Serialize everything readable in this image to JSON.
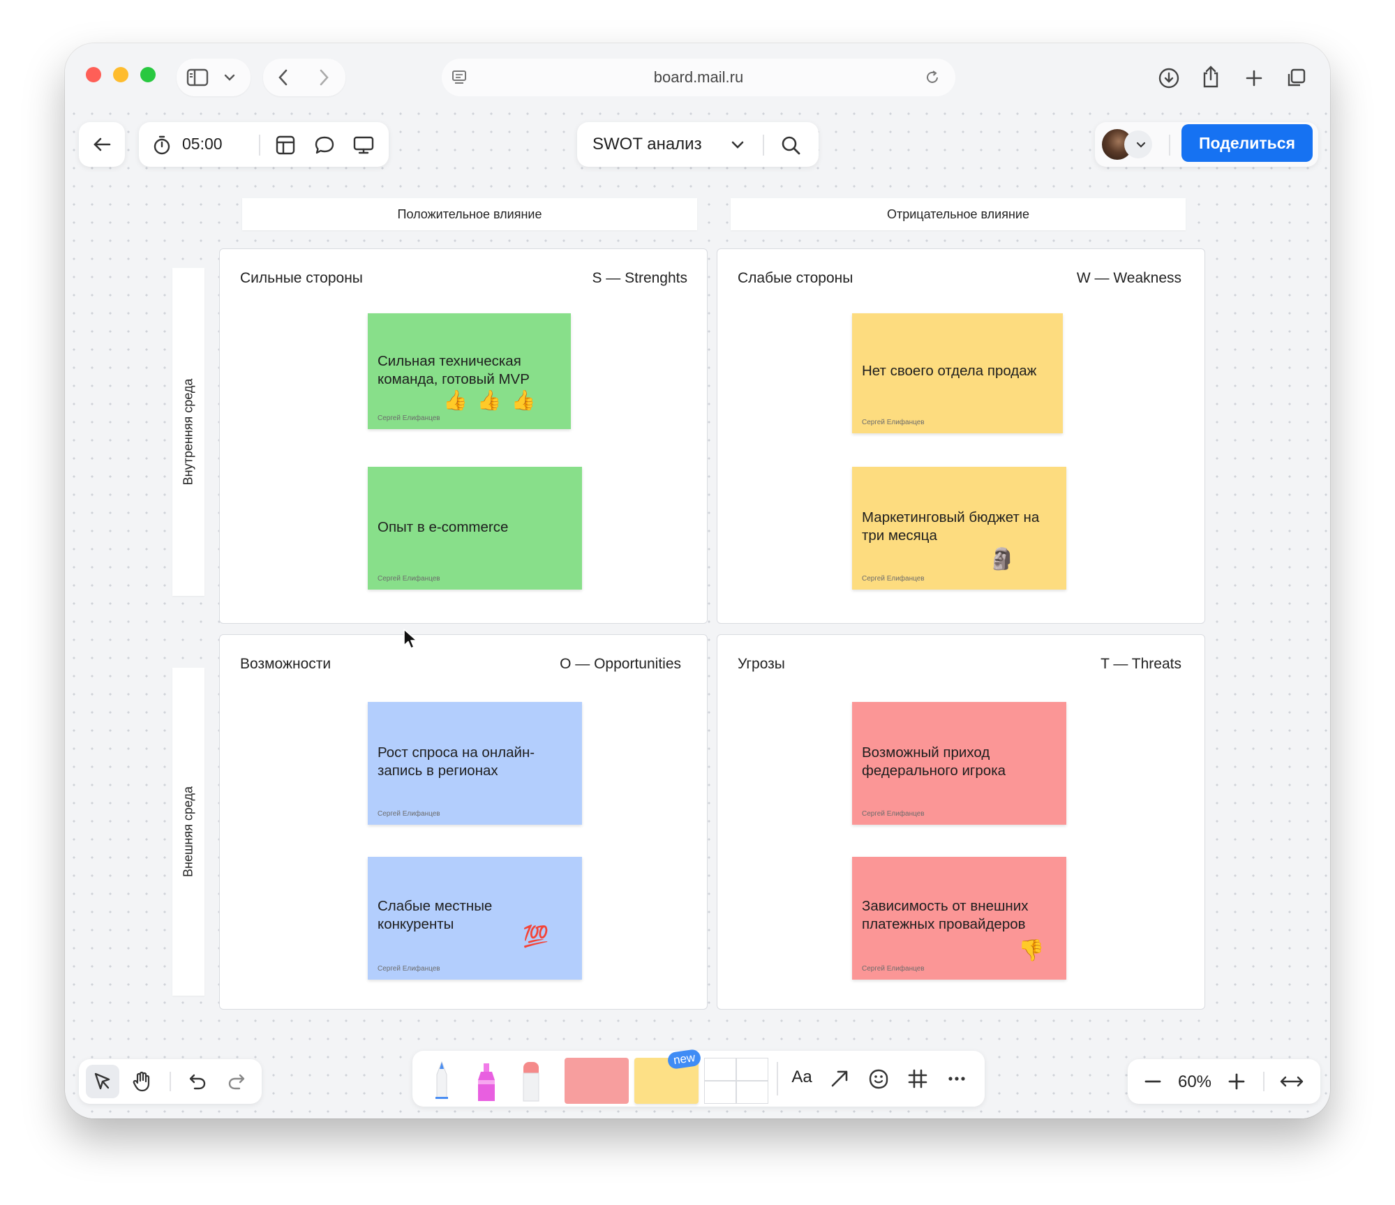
{
  "browser": {
    "url": "board.mail.ru"
  },
  "toolbar": {
    "timer": "05:00",
    "board_title": "SWOT анализ",
    "share_label": "Поделиться"
  },
  "board": {
    "col_headers": [
      "Положительное влияние",
      "Отрицательное влияние"
    ],
    "row_headers": [
      "Внутренняя среда",
      "Внешняя среда"
    ],
    "quadrants": [
      {
        "title_ru": "Сильные стороны",
        "title_en": "S — Strenghts",
        "notes": [
          {
            "text": "Сильная техническая команда, готовый MVP",
            "author": "Сергей Елифанцев",
            "emoji": "👍👍👍"
          },
          {
            "text": "Опыт в e-commerce",
            "author": "Сергей Елифанцев",
            "emoji": ""
          }
        ]
      },
      {
        "title_ru": "Слабые стороны",
        "title_en": "W — Weakness",
        "notes": [
          {
            "text": "Нет своего отдела продаж",
            "author": "Сергей Елифанцев",
            "emoji": ""
          },
          {
            "text": "Маркетинговый бюджет на три месяца",
            "author": "Сергей Елифанцев",
            "emoji": "🗿"
          }
        ]
      },
      {
        "title_ru": "Возможности",
        "title_en": "O — Opportunities",
        "notes": [
          {
            "text": "Рост спроса на онлайн-запись в регионах",
            "author": "Сергей Елифанцев",
            "emoji": ""
          },
          {
            "text": "Слабые местные конкуренты",
            "author": "Сергей Елифанцев",
            "emoji": "💯"
          }
        ]
      },
      {
        "title_ru": "Угрозы",
        "title_en": "T — Threats",
        "notes": [
          {
            "text": "Возможный приход федерального игрока",
            "author": "Сергей Елифанцев",
            "emoji": ""
          },
          {
            "text": "Зависимость от внешних платежных провайдеров",
            "author": "Сергей Елифанцев",
            "emoji": "👎"
          }
        ]
      }
    ]
  },
  "bottom": {
    "new_badge": "new",
    "text_tool": "Aa",
    "zoom": "60%"
  },
  "colors": {
    "accent": "#1672f2",
    "note_green": "#88df8a",
    "note_yellow": "#fddc7f",
    "note_blue": "#b3cefd",
    "note_red": "#fb9696"
  }
}
